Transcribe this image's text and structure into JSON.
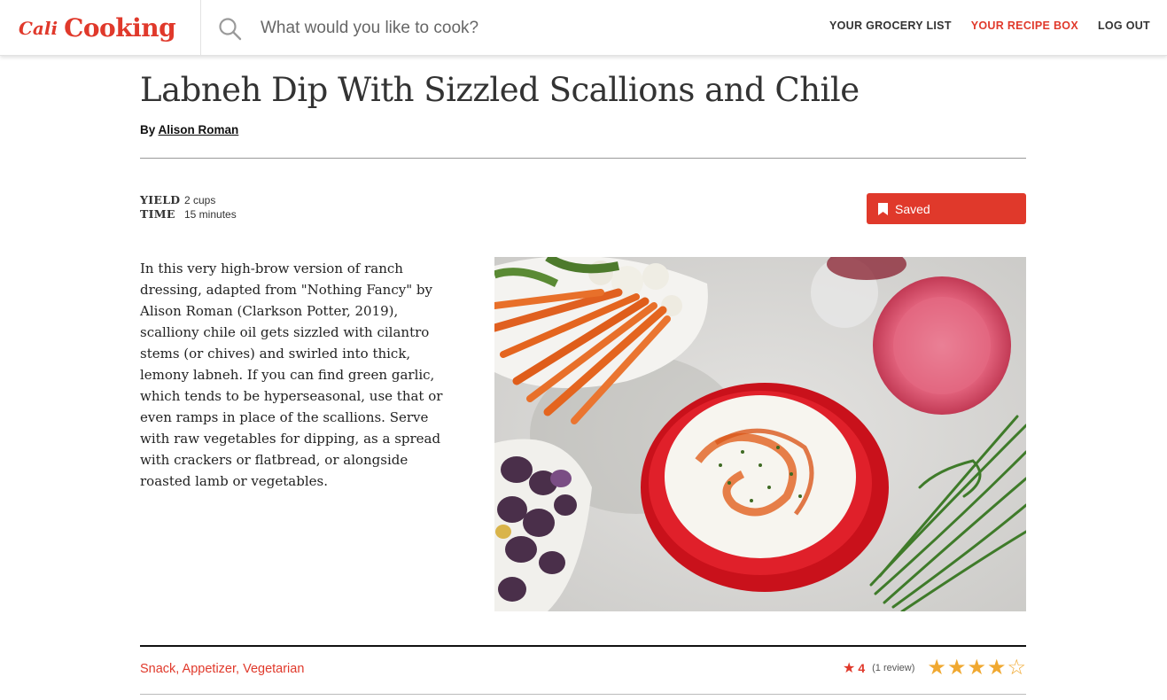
{
  "header": {
    "brand_prefix": "Cali",
    "brand_name": "Cooking",
    "search": {
      "placeholder": "What would you like to cook?"
    },
    "nav": [
      {
        "label": "YOUR GROCERY LIST",
        "active": false
      },
      {
        "label": "YOUR RECIPE BOX",
        "active": true
      },
      {
        "label": "LOG OUT",
        "active": false
      }
    ]
  },
  "recipe": {
    "title": "Labneh Dip With Sizzled Scallions and Chile",
    "by_prefix": "By",
    "author": "Alison Roman",
    "yield_label": "YIELD",
    "yield_value": "2 cups",
    "time_label": "TIME",
    "time_value": "15 minutes",
    "save_label": "Saved",
    "description": "In this very high-brow version of ranch dressing, adapted from \"Nothing Fancy\" by Alison Roman (Clarkson Potter, 2019), scalliony chile oil gets sizzled with cilantro stems (or chives) and swirled into thick, lemony labneh. If you can find green garlic, which tends to be hyperseasonal, use that or even ramps in place of the scallions. Serve with raw vegetables for dipping, as a spread with crackers or flatbread, or alongside roasted lamb or vegetables.",
    "tags": "Snack, Appetizer, Vegetarian",
    "rating_value": "4",
    "rating_count": "(1 review)",
    "stars_filled": 4,
    "stars_total": 5
  },
  "colors": {
    "accent": "#e0392b",
    "star": "#f0a830"
  }
}
